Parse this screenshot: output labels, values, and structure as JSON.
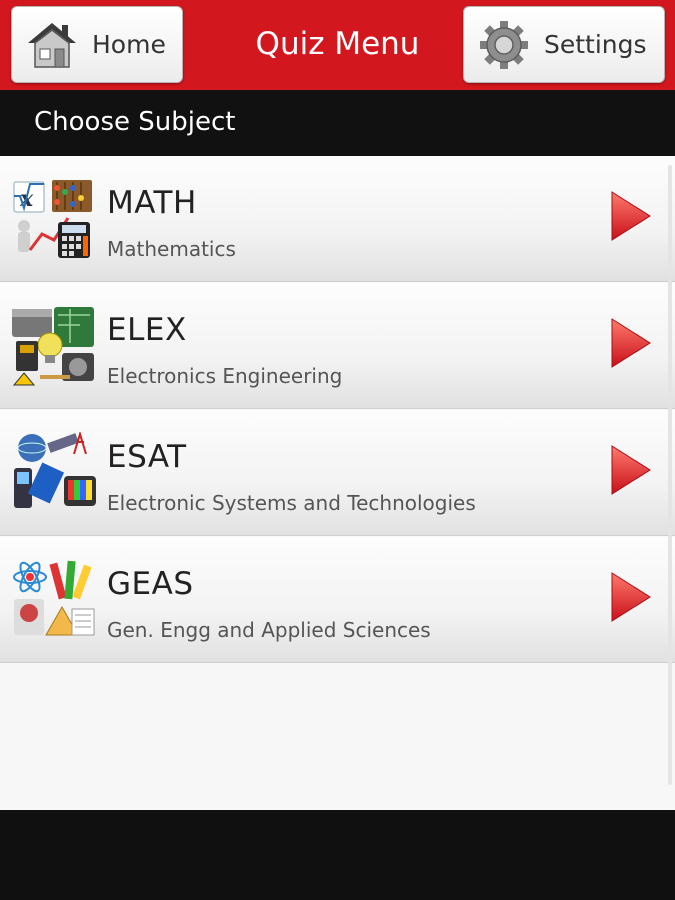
{
  "header": {
    "title": "Quiz Menu",
    "home_label": "Home",
    "settings_label": "Settings",
    "home_icon": "house-icon",
    "settings_icon": "gear-icon",
    "background_color": "#d2171e"
  },
  "subheader": {
    "label": "Choose Subject"
  },
  "subjects": [
    {
      "name": "MATH",
      "description": "Mathematics",
      "icon": "math-subject-icon"
    },
    {
      "name": "ELEX",
      "description": "Electronics Engineering",
      "icon": "electronics-subject-icon"
    },
    {
      "name": "ESAT",
      "description": "Electronic Systems and Technologies",
      "icon": "esat-subject-icon"
    },
    {
      "name": "GEAS",
      "description": "Gen. Engg and Applied Sciences",
      "icon": "geas-subject-icon"
    }
  ],
  "accent_color": "#e8222a"
}
